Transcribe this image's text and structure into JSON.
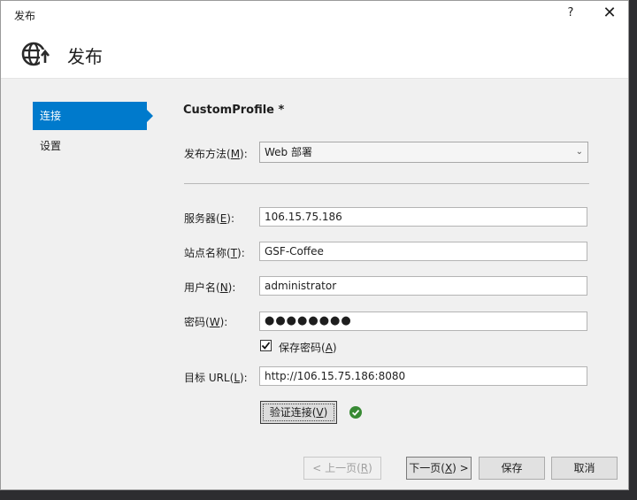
{
  "window": {
    "title": "发布",
    "help_label": "?",
    "close_label": "✕"
  },
  "header": {
    "title": "发布",
    "icon": "globe-publish-icon"
  },
  "nav": {
    "items": [
      {
        "label": "连接",
        "active": true
      },
      {
        "label": "设置",
        "active": false
      }
    ]
  },
  "profile": {
    "name": "CustomProfile *"
  },
  "form": {
    "method_label": "发布方法(",
    "method_key": "M",
    "method_value": "Web 部署",
    "server_label": "服务器(",
    "server_key": "E",
    "server_value": "106.15.75.186",
    "site_label": "站点名称(",
    "site_key": "T",
    "site_value": "GSF-Coffee",
    "user_label": "用户名(",
    "user_key": "N",
    "user_value": "administrator",
    "password_label": "密码(",
    "password_key": "W",
    "password_value": "●●●●●●●●",
    "save_password_label": "保存密码(",
    "save_password_key": "A",
    "save_password_checked": true,
    "url_label": "目标 URL(",
    "url_key": "L",
    "url_value": "http://106.15.75.186:8080",
    "label_suffix": "):",
    "verify_label": "验证连接(",
    "verify_key": "V",
    "verify_status": "success",
    "close_paren": ")"
  },
  "footer": {
    "prev_label": "< 上一页(",
    "prev_key": "R",
    "next_label": "下一页(",
    "next_key": "X",
    "next_suffix": ") >",
    "save_label": "保存",
    "cancel_label": "取消"
  },
  "colors": {
    "accent": "#007acc",
    "success": "#388a34"
  }
}
